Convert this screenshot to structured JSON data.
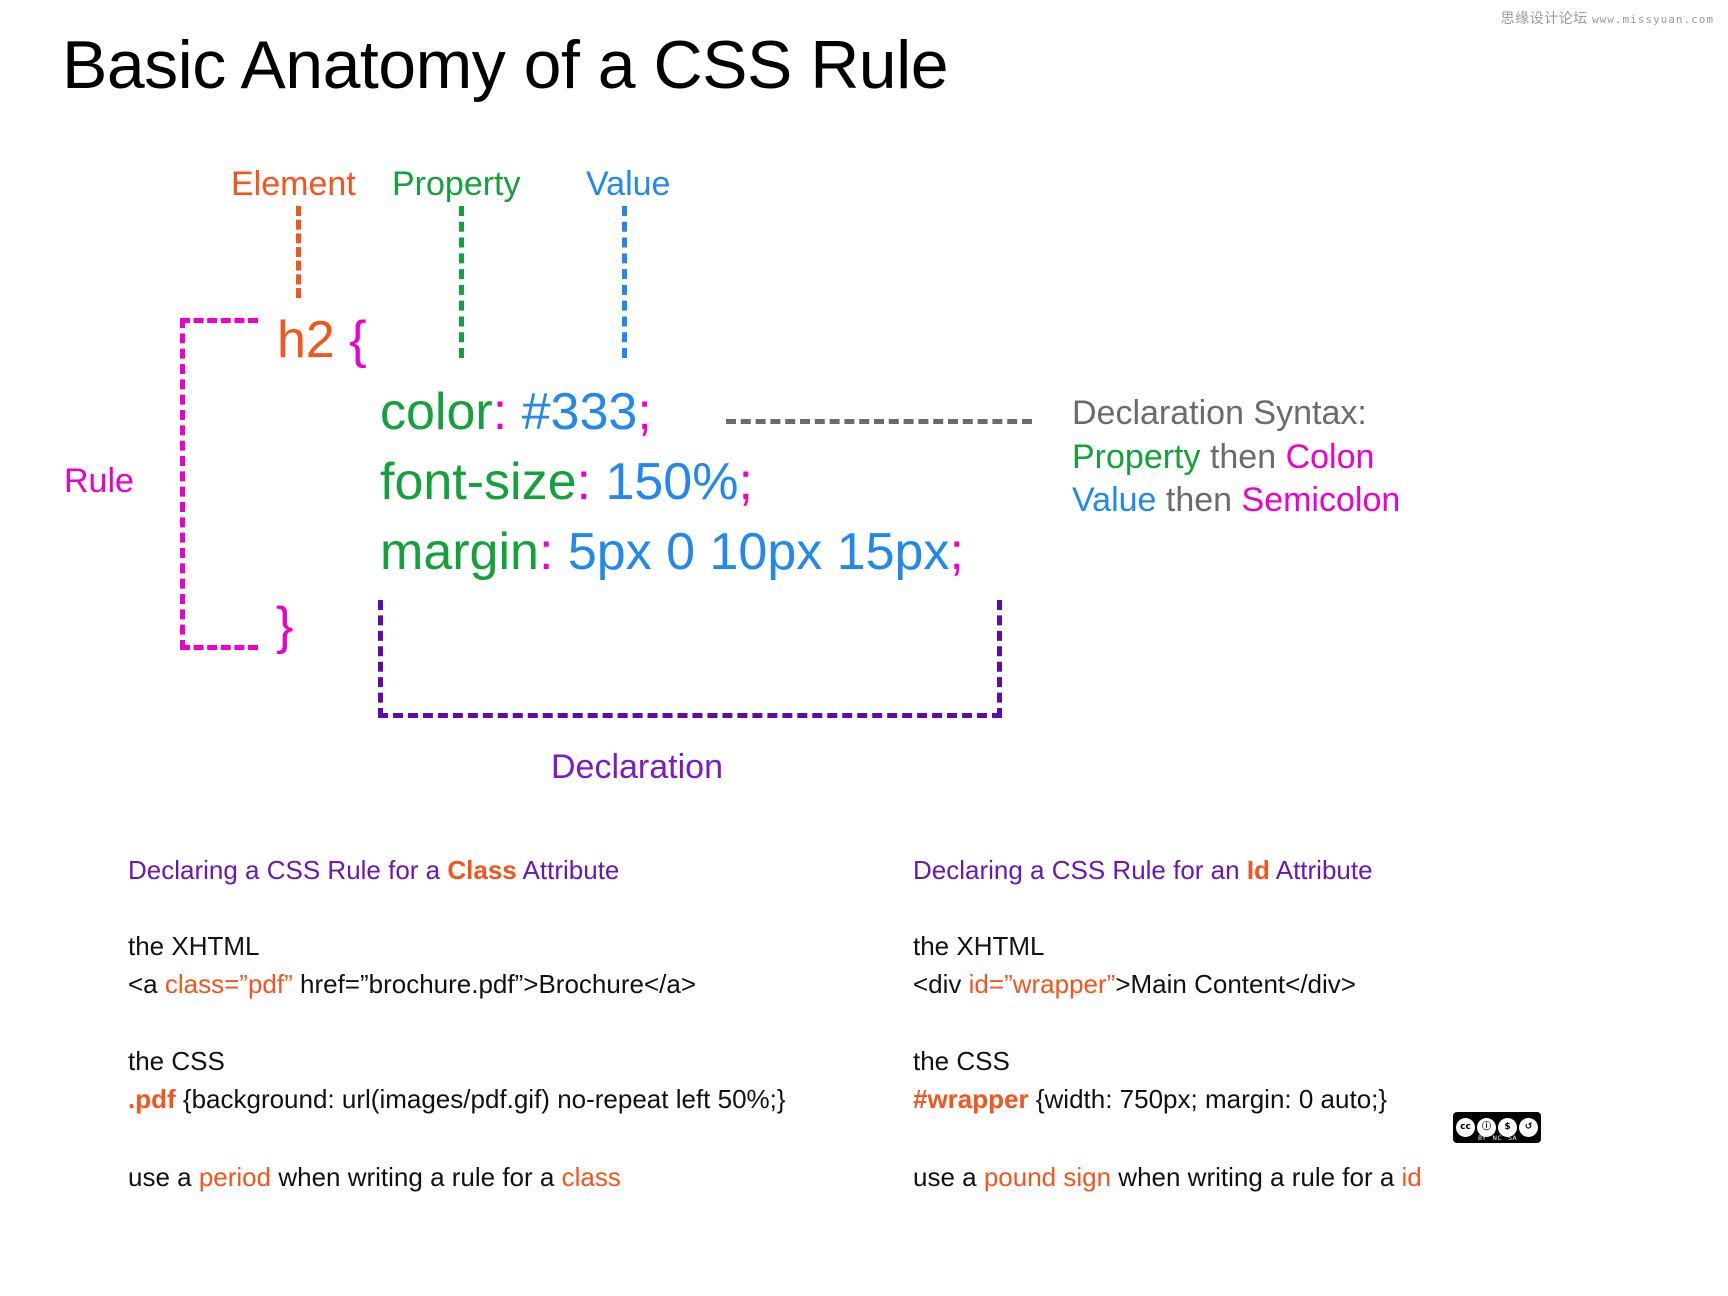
{
  "watermark": {
    "text": "思缘设计论坛",
    "url": "www.missyuan.com"
  },
  "title": "Basic Anatomy of a CSS Rule",
  "callouts": {
    "element": "Element",
    "property": "Property",
    "value": "Value"
  },
  "rule": {
    "label": "Rule"
  },
  "code": {
    "selector": "h2 ",
    "open_brace": "{",
    "close_brace": "}",
    "lines": [
      {
        "property": "color",
        "colon": ":",
        "space": "  ",
        "value": "#333",
        "semicolon": ";"
      },
      {
        "property": "font-size",
        "colon": ":",
        "space": "  ",
        "value": "150%",
        "semicolon": ";"
      },
      {
        "property": "margin",
        "colon": ":",
        "space": "  ",
        "value": "5px 0 10px 15px",
        "semicolon": ";"
      }
    ]
  },
  "syntax_note": {
    "heading": "Declaration Syntax:",
    "line2_a": "Property",
    "line2_b": " then ",
    "line2_c": "Colon",
    "line3_a": "Value",
    "line3_b": " then ",
    "line3_c": "Semicolon"
  },
  "declaration": {
    "label": "Declaration"
  },
  "columns": {
    "left": {
      "heading_a": "Declaring a CSS Rule for a ",
      "heading_hl": "Class",
      "heading_b": " Attribute",
      "xhtml_label": "the XHTML",
      "xhtml_code_a": "<a ",
      "xhtml_code_hl": "class=”pdf”",
      "xhtml_code_b": " href=”brochure.pdf”>Brochure</a>",
      "css_label": "the CSS",
      "css_code_hl": ".pdf",
      "css_code_b": " {background: url(images/pdf.gif) no-repeat left 50%;}",
      "tip_a": "use a ",
      "tip_hl1": "period",
      "tip_b": " when writing a rule for a ",
      "tip_hl2": "class"
    },
    "right": {
      "heading_a": "Declaring a CSS Rule for an ",
      "heading_hl": "Id",
      "heading_b": " Attribute",
      "xhtml_label": "the XHTML",
      "xhtml_code_a": "<div ",
      "xhtml_code_hl": "id=”wrapper”",
      "xhtml_code_b": ">Main Content</div>",
      "css_label": "the CSS",
      "css_code_hl": "#wrapper",
      "css_code_b": " {width: 750px; margin: 0 auto;}",
      "tip_a": "use a ",
      "tip_hl1": "pound sign",
      "tip_b": " when writing a rule for a ",
      "tip_hl2": "id"
    }
  },
  "cc_badge": {
    "cc": "cc",
    "by_glyph": "ⓘ",
    "nc_glyph": "$",
    "sa_glyph": "↺",
    "by": "BY",
    "nc": "NC",
    "sa": "SA"
  },
  "colors": {
    "element_orange": "#f4551f",
    "property_green": "#14a03a",
    "value_blue": "#2288ee",
    "punct_magenta": "#ee00cc",
    "declaration_purple": "#5c0bb0",
    "note_gray": "#6b6b6b",
    "heading_purple": "#6a18b5"
  }
}
